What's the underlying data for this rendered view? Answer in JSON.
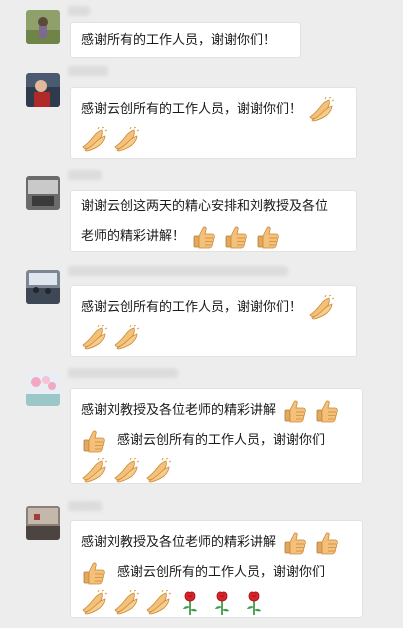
{
  "messages": [
    {
      "lines": [
        "感谢所有的工作人员，谢谢你们！"
      ]
    },
    {
      "lines": [
        "感谢云创所有的工作人员，谢谢你们！"
      ]
    },
    {
      "lines": [
        "谢谢云创这两天的精心安排和刘教授及各位",
        "老师的精彩讲解！"
      ]
    },
    {
      "lines": [
        "感谢云创所有的工作人员，谢谢你们！"
      ]
    },
    {
      "lines": [
        "感谢刘教授及各位老师的精彩讲解",
        "感谢云创所有的工作人员，谢谢你们"
      ]
    },
    {
      "lines": [
        "感谢刘教授及各位老师的精彩讲解",
        "感谢云创所有的工作人员，谢谢你们"
      ]
    }
  ],
  "icons": {
    "clap": "clapping-hands-emoji",
    "thumb": "thumbs-up-emoji",
    "rose": "rose-emoji"
  },
  "colors": {
    "background": "#ededed",
    "bubble": "#ffffff",
    "text": "#1a1a1a",
    "emoji_skin": "#f5c17a"
  }
}
